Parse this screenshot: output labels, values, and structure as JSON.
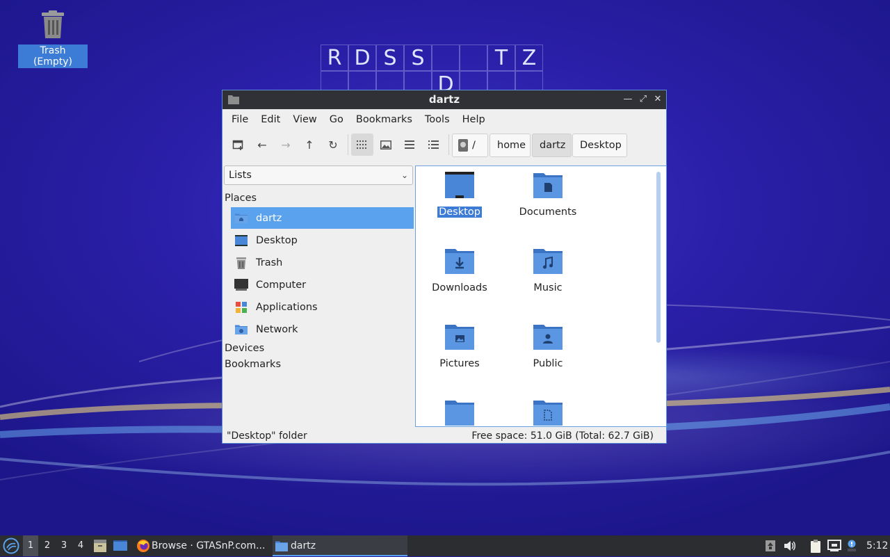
{
  "desktop": {
    "trash_label": "Trash (Empty)",
    "grid_letters": [
      "R",
      "D",
      "S",
      "S",
      "",
      "",
      "T",
      "Z",
      "",
      "",
      "",
      "",
      "D",
      "",
      "",
      ""
    ]
  },
  "window": {
    "title": "dartz",
    "menu": [
      "File",
      "Edit",
      "View",
      "Go",
      "Bookmarks",
      "Tools",
      "Help"
    ],
    "breadcrumbs": [
      "/",
      "home",
      "dartz",
      "Desktop"
    ],
    "side_dropdown": "Lists",
    "places_header": "Places",
    "places": [
      "dartz",
      "Desktop",
      "Trash",
      "Computer",
      "Applications",
      "Network"
    ],
    "devices_header": "Devices",
    "bookmarks_header": "Bookmarks",
    "items": [
      "Desktop",
      "Documents",
      "Downloads",
      "Music",
      "Pictures",
      "Public",
      "",
      ""
    ],
    "status_left": "\"Desktop\" folder",
    "status_right": "Free space: 51.0 GiB (Total: 62.7 GiB)"
  },
  "taskbar": {
    "workspaces": [
      "1",
      "2",
      "3",
      "4"
    ],
    "tasks": [
      "Browse · GTASnP.com...",
      "dartz"
    ],
    "clock": "5:12"
  },
  "colors": {
    "accent": "#5aa1ee",
    "folder": "#4a86d8",
    "titlebar": "#2f3136",
    "taskbar": "#2b2d31"
  }
}
